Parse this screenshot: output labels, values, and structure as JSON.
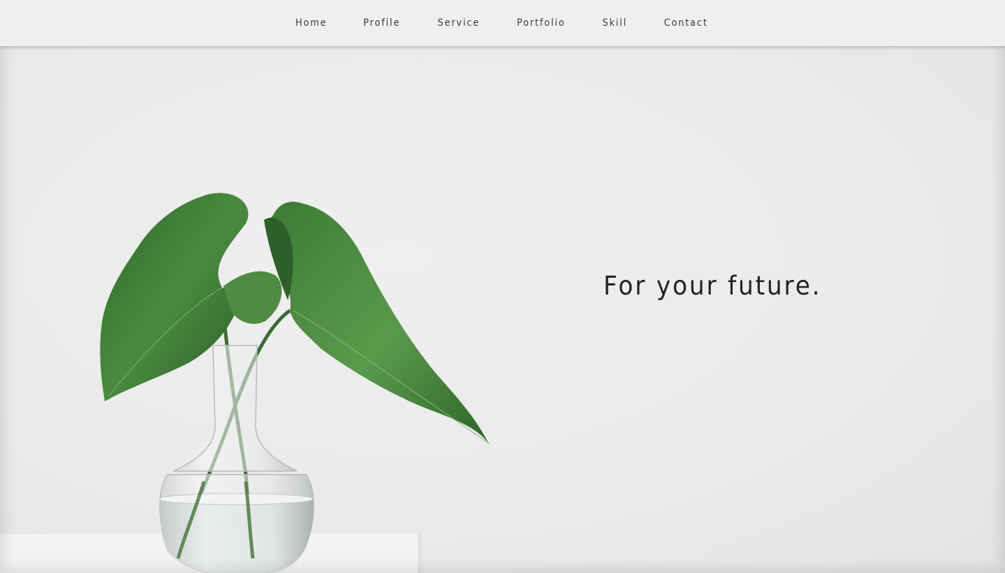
{
  "nav": {
    "items": [
      {
        "label": "Home"
      },
      {
        "label": "Profile"
      },
      {
        "label": "Service"
      },
      {
        "label": "Portfolio"
      },
      {
        "label": "Skill"
      },
      {
        "label": "Contact"
      }
    ]
  },
  "hero": {
    "title": "For your future."
  },
  "colors": {
    "background": "#ebebeb",
    "navbar": "#efefef",
    "text": "#222222",
    "leaf": "#3f7a3a"
  }
}
